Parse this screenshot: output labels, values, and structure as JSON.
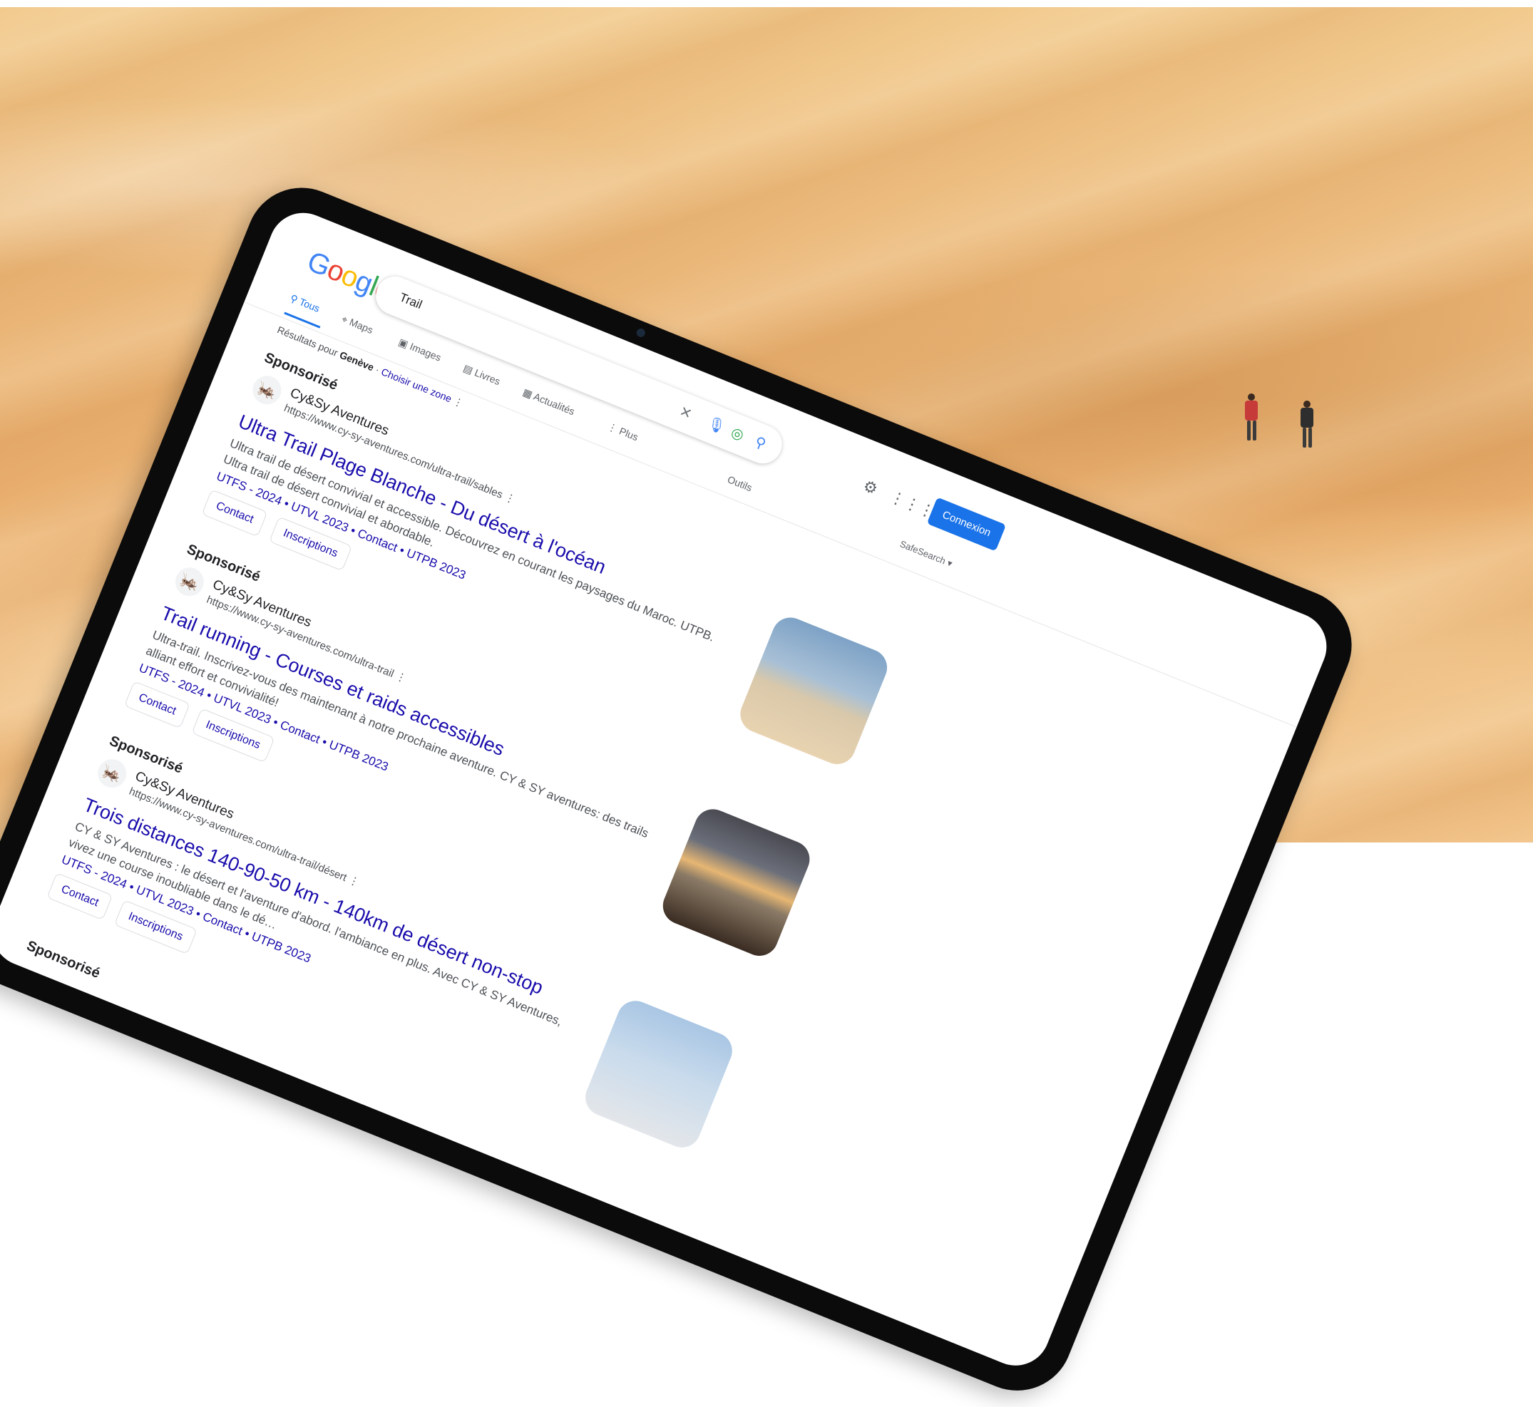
{
  "search": {
    "logo_letters": [
      "G",
      "o",
      "o",
      "g",
      "l",
      "e"
    ],
    "logo_colors": [
      "#4285F4",
      "#EA4335",
      "#FBBC05",
      "#4285F4",
      "#34A853",
      "#EA4335"
    ],
    "query": "Trail",
    "clear_icon": "close-icon",
    "mic_icon": "microphone-icon",
    "lens_icon": "camera-lens-icon",
    "search_icon": "search-icon"
  },
  "tabs": [
    {
      "label": "Tous",
      "icon": "search-icon"
    },
    {
      "label": "Maps",
      "icon": "map-pin-icon"
    },
    {
      "label": "Images",
      "icon": "image-icon"
    },
    {
      "label": "Livres",
      "icon": "book-icon"
    },
    {
      "label": "Actualités",
      "icon": "news-icon"
    },
    {
      "label": "Plus",
      "icon": "more-vertical-icon"
    }
  ],
  "outils_label": "Outils",
  "location": {
    "prefix": "Résultats pour",
    "city": "Genève",
    "link": "Choisir une zone"
  },
  "header_right": {
    "signin_label": "Connexion",
    "safesearch_label": "SafeSearch"
  },
  "ads": [
    {
      "sponsored": "Sponsorisé",
      "advertiser": "Cy&Sy Aventures",
      "url": "https://www.cy-sy-aventures.com/ultra-trail/sables",
      "title": "Ultra Trail Plage Blanche - Du désert à l'océan",
      "description": "Ultra trail de désert convivial et accessible. Découvrez en courant les paysages du Maroc. UTPB. Ultra trail de désert convivial et abordable.",
      "sitelinks": "UTFS - 2024 • UTVL 2023 • Contact • UTPB 2023",
      "chips": [
        "Contact",
        "Inscriptions"
      ]
    },
    {
      "sponsored": "Sponsorisé",
      "advertiser": "Cy&Sy Aventures",
      "url": "https://www.cy-sy-aventures.com/ultra-trail",
      "title": "Trail running - Courses et raids accessibles",
      "description": "Ultra-trail. Inscrivez-vous des maintenant à notre prochaine aventure. CY & SY aventures: des trails alliant effort et convivialité!",
      "sitelinks": "UTFS - 2024 • UTVL 2023 • Contact • UTPB 2023",
      "chips": [
        "Contact",
        "Inscriptions"
      ]
    },
    {
      "sponsored": "Sponsorisé",
      "advertiser": "Cy&Sy Aventures",
      "url": "https://www.cy-sy-aventures.com/ultra-trail/désert",
      "title": "Trois distances 140-90-50 km - 140km de désert non-stop",
      "description": "CY & SY Aventures : le désert et l'aventure d'abord. l'ambiance en plus. Avec CY & SY Aventures, vivez une course inoubliable dans le dé…",
      "sitelinks": "UTFS - 2024 • UTVL 2023 • Contact • UTPB 2023",
      "chips": [
        "Contact",
        "Inscriptions"
      ]
    },
    {
      "sponsored": "Sponsorisé"
    }
  ]
}
